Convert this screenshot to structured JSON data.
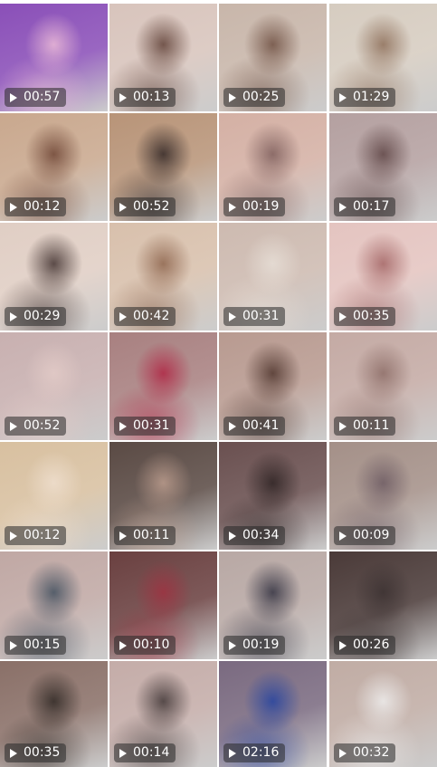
{
  "grid": {
    "tiles": [
      {
        "duration": "00:57",
        "bg": "#8a4fb8",
        "accent": "#f0c0d8"
      },
      {
        "duration": "00:13",
        "bg": "#d8c4bc",
        "accent": "#5a3a30"
      },
      {
        "duration": "00:25",
        "bg": "#c8b6aa",
        "accent": "#6a4a3c"
      },
      {
        "duration": "01:29",
        "bg": "#d6ccc0",
        "accent": "#8a6a54"
      },
      {
        "duration": "00:12",
        "bg": "#c9a88e",
        "accent": "#6a4030"
      },
      {
        "duration": "00:52",
        "bg": "#b89478",
        "accent": "#2a2020"
      },
      {
        "duration": "00:19",
        "bg": "#d4b0a4",
        "accent": "#7a5a58"
      },
      {
        "duration": "00:17",
        "bg": "#b4a0a0",
        "accent": "#5a4040"
      },
      {
        "duration": "00:29",
        "bg": "#e0cec4",
        "accent": "#3a2a28"
      },
      {
        "duration": "00:42",
        "bg": "#d8c0ac",
        "accent": "#8a6048"
      },
      {
        "duration": "00:31",
        "bg": "#cdbab0",
        "accent": "#e8e0d8"
      },
      {
        "duration": "00:35",
        "bg": "#e4c4c0",
        "accent": "#a06060"
      },
      {
        "duration": "00:52",
        "bg": "#c8b0b0",
        "accent": "#e4ccc8"
      },
      {
        "duration": "00:31",
        "bg": "#a88080",
        "accent": "#b02040"
      },
      {
        "duration": "00:41",
        "bg": "#b89a90",
        "accent": "#4a3028"
      },
      {
        "duration": "00:11",
        "bg": "#c4aaa4",
        "accent": "#8a6a64"
      },
      {
        "duration": "00:12",
        "bg": "#d8c0a0",
        "accent": "#f0e0d0"
      },
      {
        "duration": "00:11",
        "bg": "#5a4a44",
        "accent": "#c0a090"
      },
      {
        "duration": "00:34",
        "bg": "#6a5050",
        "accent": "#2a2020"
      },
      {
        "duration": "00:09",
        "bg": "#a49088",
        "accent": "#6a5860"
      },
      {
        "duration": "00:15",
        "bg": "#c0a8a4",
        "accent": "#3a4a5a"
      },
      {
        "duration": "00:10",
        "bg": "#6a4040",
        "accent": "#a03040"
      },
      {
        "duration": "00:19",
        "bg": "#b8a8a4",
        "accent": "#2a2a3a"
      },
      {
        "duration": "00:26",
        "bg": "#4a3a38",
        "accent": "#3a3030"
      },
      {
        "duration": "00:35",
        "bg": "#8a7068",
        "accent": "#2a2420"
      },
      {
        "duration": "00:14",
        "bg": "#c4aca8",
        "accent": "#3a3030"
      },
      {
        "duration": "02:16",
        "bg": "#7a6a80",
        "accent": "#2040a0"
      },
      {
        "duration": "00:32",
        "bg": "#c0aca4",
        "accent": "#f0f0f0"
      }
    ]
  },
  "icons": {
    "play": "play-icon"
  }
}
